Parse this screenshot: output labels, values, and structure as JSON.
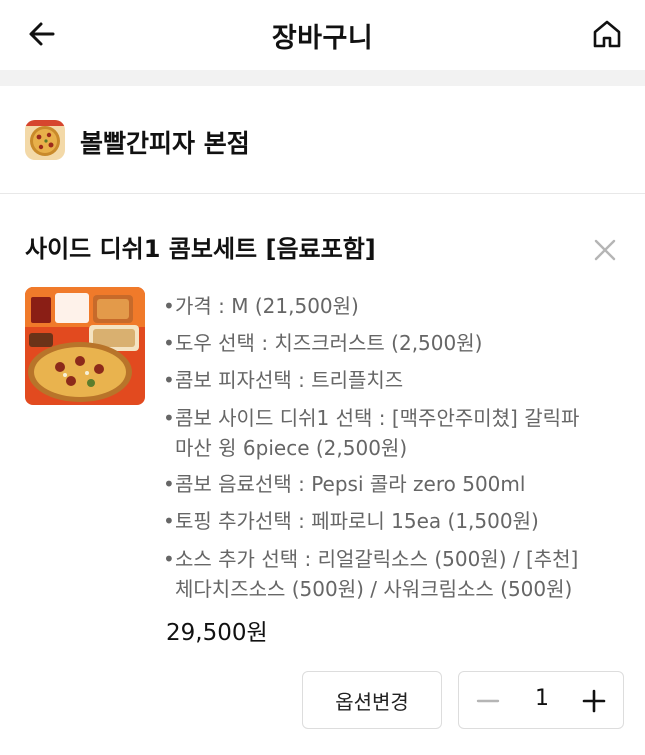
{
  "header": {
    "title": "장바구니",
    "back_icon": "arrow-left-icon",
    "home_icon": "home-icon"
  },
  "store": {
    "name": "볼빨간피자 본점",
    "logo_icon": "store-logo"
  },
  "cart_item": {
    "title": "사이드 디쉬1 콤보세트 [음료포함]",
    "remove_icon": "close-icon",
    "options": [
      "가격 : M (21,500원)",
      "도우 선택 : 치즈크러스트 (2,500원)",
      "콤보 피자선택 : 트리플치즈",
      "콤보 사이드 디쉬1 선택 : [맥주안주미쳤] 갈릭파마산 윙 6piece (2,500원)",
      "콤보 음료선택 : Pepsi 콜라 zero 500ml",
      "토핑 추가선택 : 페파로니 15ea (1,500원)",
      "소스 추가 선택 : 리얼갈릭소스 (500원) / [추천]체다치즈소스 (500원) / 사워크림소스 (500원)"
    ],
    "option_lines": [
      [
        "가격 : M (21,500원)"
      ],
      [
        "도우 선택 : 치즈크러스트 (2,500원)"
      ],
      [
        "콤보 피자선택 : 트리플치즈"
      ],
      [
        "콤보 사이드 디쉬1 선택 : [맥주안주미쳤] 갈릭파",
        "마산 윙 6piece (2,500원)"
      ],
      [
        "콤보 음료선택 : Pepsi 콜라 zero 500ml"
      ],
      [
        "토핑 추가선택 : 페파로니 15ea (1,500원)"
      ],
      [
        "소스 추가 선택 : 리얼갈릭소스 (500원) / [추천]",
        "체다치즈소스 (500원) / 사워크림소스 (500원)"
      ]
    ],
    "price": "29,500원",
    "option_change_label": "옵션변경",
    "quantity": "1",
    "minus_icon": "minus-icon",
    "plus_icon": "plus-icon"
  },
  "colors": {
    "text_primary": "#111111",
    "text_secondary": "#666666",
    "divider_band": "#f2f2f2",
    "border": "#dddddd"
  }
}
